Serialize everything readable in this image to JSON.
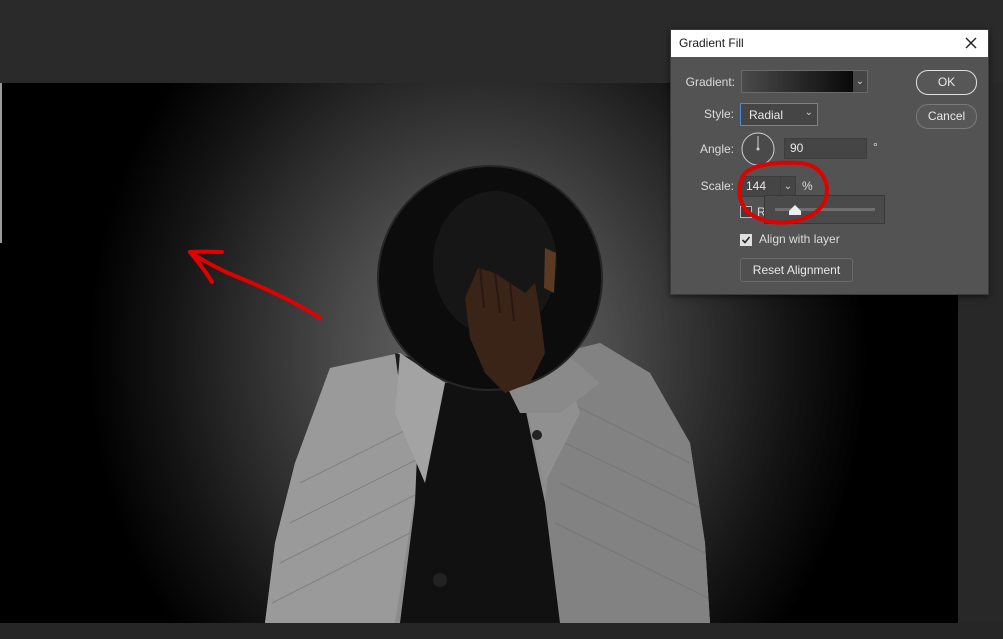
{
  "dialog": {
    "title": "Gradient Fill",
    "close_icon": "close-icon",
    "gradient_label": "Gradient:",
    "style_label": "Style:",
    "style_value": "Radial",
    "angle_label": "Angle:",
    "angle_value": "90",
    "angle_unit": "°",
    "scale_label": "Scale:",
    "scale_value": "144",
    "scale_unit": "%",
    "scale_slider_fraction": 0.2,
    "reverse_partial_label": "R",
    "align_label": "Align with layer",
    "align_checked": true,
    "reset_label": "Reset Alignment",
    "ok_label": "OK",
    "cancel_label": "Cancel",
    "dropdown_icon": "chevron-down-icon"
  },
  "canvas": {
    "content": "photo-person-hat",
    "annotation_color": "#e00000"
  },
  "colors": {
    "dialog_bg": "#535353",
    "title_bar": "#ffffff",
    "focus_border": "#4a8cd8",
    "annotation": "#e00000"
  }
}
